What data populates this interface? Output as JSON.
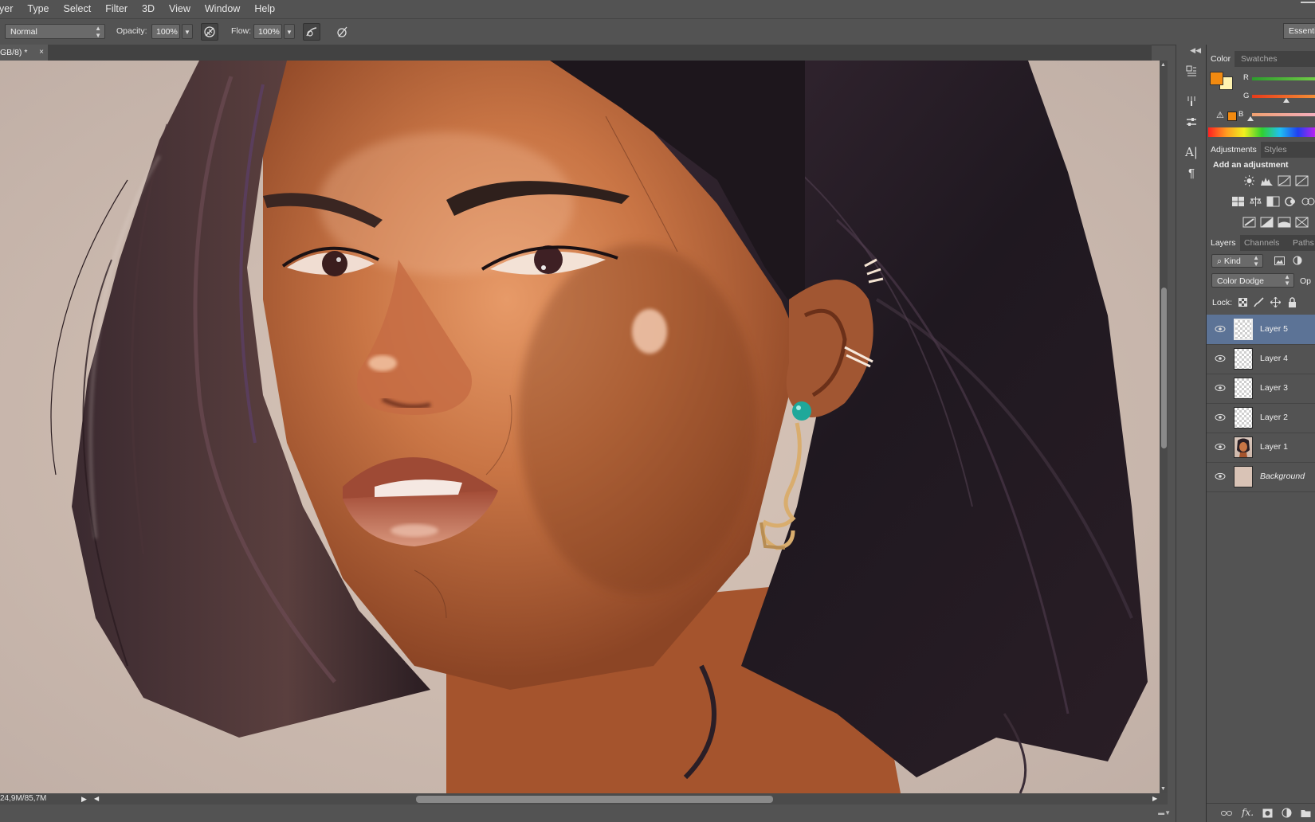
{
  "menu": [
    "yer",
    "Type",
    "Select",
    "Filter",
    "3D",
    "View",
    "Window",
    "Help"
  ],
  "options": {
    "blend_mode": "Normal",
    "opacity_label": "Opacity:",
    "opacity_value": "100%",
    "flow_label": "Flow:",
    "flow_value": "100%",
    "workspace": "Essenti"
  },
  "document": {
    "tab_title": "GB/8) *",
    "tab_close": "×",
    "doc_info": "24,9M/85,7M"
  },
  "panels": {
    "color": {
      "tabs": [
        "Color",
        "Swatches"
      ],
      "channels": [
        "R",
        "G",
        "B"
      ],
      "foreground": "#f28a10",
      "background": "#fff3b0"
    },
    "adjustments": {
      "tabs": [
        "Adjustments",
        "Styles"
      ],
      "heading": "Add an adjustment"
    },
    "layers": {
      "tabs": [
        "Layers",
        "Channels",
        "Paths"
      ],
      "filter_kind": "Kind",
      "blend_mode": "Color Dodge",
      "opacity_label_partial": "Op",
      "lock_label": "Lock:",
      "items": [
        {
          "name": "Layer 5",
          "selected": true,
          "thumb": "transparent"
        },
        {
          "name": "Layer 4",
          "selected": false,
          "thumb": "transparent"
        },
        {
          "name": "Layer 3",
          "selected": false,
          "thumb": "transparent"
        },
        {
          "name": "Layer 2",
          "selected": false,
          "thumb": "transparent"
        },
        {
          "name": "Layer 1",
          "selected": false,
          "thumb": "portrait"
        },
        {
          "name": "Background",
          "selected": false,
          "thumb": "solid"
        }
      ]
    }
  },
  "colors": {
    "ui_bg": "#535353",
    "selection": "#5c7396",
    "accent_teal": "#1fa89a"
  }
}
